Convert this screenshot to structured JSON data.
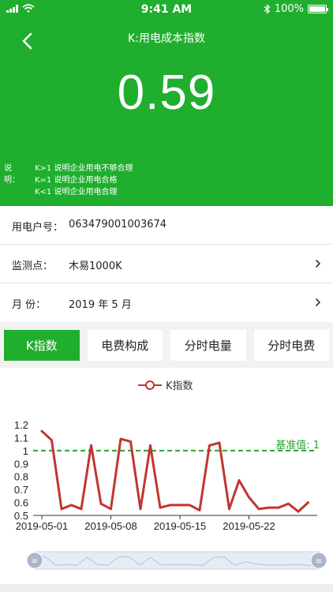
{
  "status_bar": {
    "time": "9:41 AM",
    "battery": "100%",
    "battery_level": 1.0
  },
  "header": {
    "title": "K:用电成本指数",
    "k_value": "0.59",
    "explain_label": "说明：",
    "explain_lines": [
      "K>1 说明企业用电不够合理",
      "K=1 说明企业用电合格",
      "K<1 说明企业用电合理"
    ]
  },
  "info": {
    "account_label": "用电户号：",
    "account_value": "063479001003674",
    "monitor_label": "监测点：",
    "monitor_value": "木易1000K",
    "month_label": "月 份：",
    "month_value": "2019 年 5 月"
  },
  "tabs": [
    {
      "label": "K指数",
      "active": true
    },
    {
      "label": "电费构成",
      "active": false
    },
    {
      "label": "分时电量",
      "active": false
    },
    {
      "label": "分时电费",
      "active": false
    }
  ],
  "colors": {
    "brand_green": "#1fae2d",
    "line_red": "#c23531",
    "baseline_green": "#27a32f"
  },
  "chart_data": {
    "type": "line",
    "series": [
      {
        "name": "K指数",
        "x": [
          "2019-05-01",
          "2019-05-02",
          "2019-05-03",
          "2019-05-04",
          "2019-05-05",
          "2019-05-06",
          "2019-05-07",
          "2019-05-08",
          "2019-05-09",
          "2019-05-10",
          "2019-05-11",
          "2019-05-12",
          "2019-05-13",
          "2019-05-14",
          "2019-05-15",
          "2019-05-16",
          "2019-05-17",
          "2019-05-18",
          "2019-05-19",
          "2019-05-20",
          "2019-05-21",
          "2019-05-22",
          "2019-05-23",
          "2019-05-24",
          "2019-05-25",
          "2019-05-26",
          "2019-05-27",
          "2019-05-28"
        ],
        "values": [
          1.15,
          1.08,
          0.55,
          0.58,
          0.55,
          1.04,
          0.59,
          0.55,
          1.09,
          1.07,
          0.55,
          1.04,
          0.56,
          0.58,
          0.58,
          0.58,
          0.54,
          1.04,
          1.06,
          0.55,
          0.77,
          0.64,
          0.55,
          0.56,
          0.56,
          0.59,
          0.53,
          0.6
        ]
      }
    ],
    "baseline": {
      "value": 1,
      "label": "基准值: 1"
    },
    "x_ticks": [
      "2019-05-01",
      "2019-05-08",
      "2019-05-15",
      "2019-05-22"
    ],
    "y_ticks": [
      "0.5",
      "0.6",
      "0.7",
      "0.8",
      "0.9",
      "1",
      "1.1",
      "1.2"
    ],
    "ylim": [
      0.5,
      1.2
    ],
    "legend": "top-center",
    "data_zoom": {
      "start": 0,
      "end": 1
    }
  }
}
